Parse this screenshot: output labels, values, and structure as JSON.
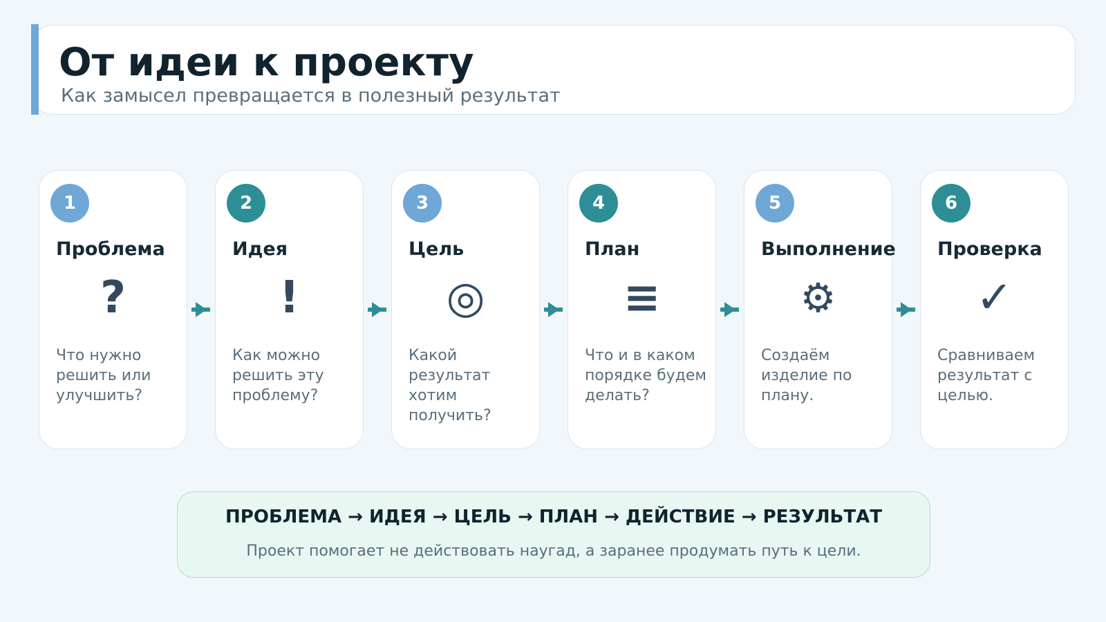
{
  "header": {
    "title": "От идеи к проекту",
    "subtitle": "Как замысел превращается в полезный результат"
  },
  "colors": {
    "background": "#f2f7fc",
    "accent_blue": "#6fa7d6",
    "accent_teal": "#2e8e96",
    "title_text": "#10232e",
    "muted_text": "#5a6e7b",
    "icon": "#34495e",
    "summary_bg": "#e7f7f2"
  },
  "steps": [
    {
      "number": "1",
      "title": "Проблема",
      "icon": "question-icon",
      "glyph": "?",
      "description": "Что нужно решить или улучшить?",
      "badge_color": "#6fa7d6"
    },
    {
      "number": "2",
      "title": "Идея",
      "icon": "exclamation-icon",
      "glyph": "!",
      "description": "Как можно решить эту проблему?",
      "badge_color": "#2e8e96"
    },
    {
      "number": "3",
      "title": "Цель",
      "icon": "target-icon",
      "glyph": "◎",
      "description": "Какой результат хотим получить?",
      "badge_color": "#6fa7d6"
    },
    {
      "number": "4",
      "title": "План",
      "icon": "list-icon",
      "glyph": "≡",
      "description": "Что и в каком порядке будем делать?",
      "badge_color": "#2e8e96"
    },
    {
      "number": "5",
      "title": "Выполнение",
      "icon": "gear-icon",
      "glyph": "⚙",
      "description": "Создаём изделие по плану.",
      "badge_color": "#6fa7d6"
    },
    {
      "number": "6",
      "title": "Проверка",
      "icon": "checkmark-icon",
      "glyph": "✓",
      "description": "Сравниваем результат с целью.",
      "badge_color": "#2e8e96"
    }
  ],
  "summary": {
    "flow": "ПРОБЛЕМА → ИДЕЯ → ЦЕЛЬ → ПЛАН → ДЕЙСТВИЕ → РЕЗУЛЬТАТ",
    "note": "Проект помогает не действовать наугад, а заранее продумать путь к цели."
  }
}
